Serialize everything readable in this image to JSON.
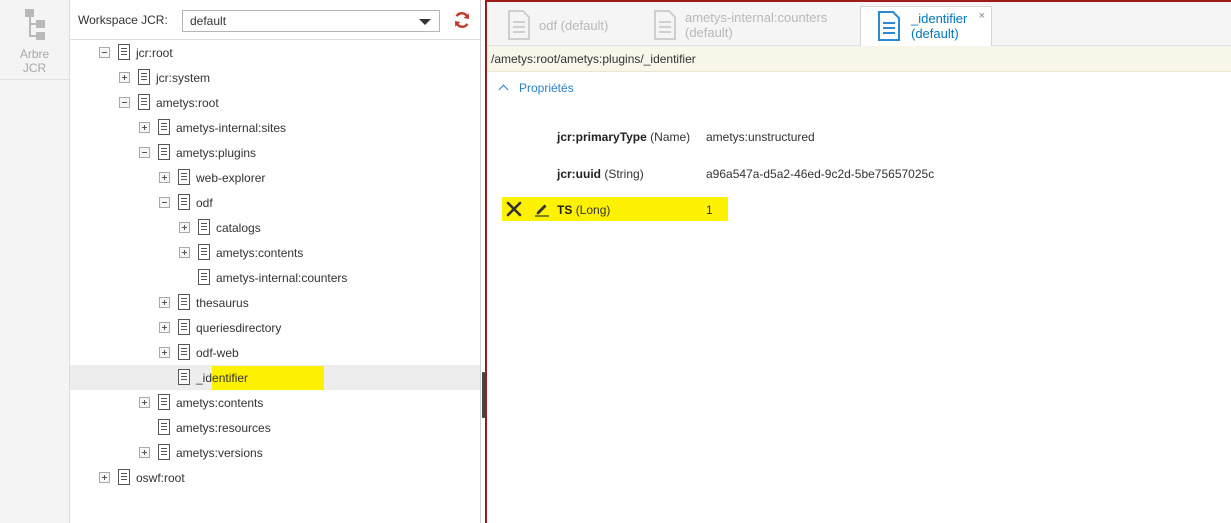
{
  "rail": {
    "label_line1": "Arbre",
    "label_line2": "JCR",
    "icon": "tree-hierarchy-icon"
  },
  "workspace": {
    "label": "Workspace JCR:",
    "value": "default"
  },
  "tree": {
    "nodes": [
      {
        "label": "jcr:root",
        "expander": "minus"
      },
      {
        "label": "jcr:system",
        "expander": "plus"
      },
      {
        "label": "ametys:root",
        "expander": "minus"
      },
      {
        "label": "ametys-internal:sites",
        "expander": "plus"
      },
      {
        "label": "ametys:plugins",
        "expander": "minus"
      },
      {
        "label": "web-explorer",
        "expander": "plus"
      },
      {
        "label": "odf",
        "expander": "minus"
      },
      {
        "label": "catalogs",
        "expander": "plus"
      },
      {
        "label": "ametys:contents",
        "expander": "plus"
      },
      {
        "label": "ametys-internal:counters",
        "expander": "none"
      },
      {
        "label": "thesaurus",
        "expander": "plus"
      },
      {
        "label": "queriesdirectory",
        "expander": "plus"
      },
      {
        "label": "odf-web",
        "expander": "plus"
      },
      {
        "label": "_identifier",
        "expander": "none",
        "selected": true
      },
      {
        "label": "ametys:contents",
        "expander": "plus"
      },
      {
        "label": "ametys:resources",
        "expander": "none"
      },
      {
        "label": "ametys:versions",
        "expander": "plus"
      },
      {
        "label": "oswf:root",
        "expander": "plus"
      }
    ]
  },
  "tabs": [
    {
      "line1": "odf (default)",
      "line2": "",
      "active": false
    },
    {
      "line1": "ametys-internal:counters",
      "line2": "(default)",
      "active": false
    },
    {
      "line1": "_identifier",
      "line2": "(default)",
      "active": true,
      "close": "×"
    }
  ],
  "path": "/ametys:root/ametys:plugins/_identifier",
  "section": {
    "title": "Propriétés"
  },
  "properties": [
    {
      "name": "jcr:primaryType",
      "type": "(Name)",
      "value": "ametys:unstructured"
    },
    {
      "name": "jcr:uuid",
      "type": "(String)",
      "value": "a96a547a-d5a2-46ed-9c2d-5be75657025c"
    },
    {
      "name": "TS",
      "type": "(Long)",
      "value": "1",
      "editable": true
    }
  ],
  "colors": {
    "accent": "#9b1b1b",
    "highlight": "#fff200",
    "link": "#2c7fc4",
    "refresh": "#c0392b"
  }
}
